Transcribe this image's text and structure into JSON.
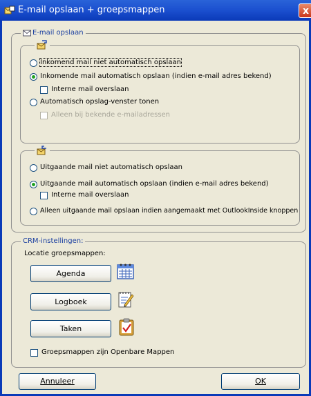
{
  "window": {
    "title": "E-mail opslaan + groepsmappen",
    "close_label": "x"
  },
  "email_section": {
    "legend": "E-mail opslaan",
    "incoming": {
      "radio_not_auto": "Inkomend mail niet automatisch opslaan",
      "radio_auto": "Inkomende mail automatisch opslaan (indien e-mail adres bekend)",
      "check_internal": "Interne mail overslaan",
      "radio_window": "Automatisch opslag-venster tonen",
      "check_known_only": "Alleen bij bekende e-mailadressen",
      "selected": "auto"
    },
    "outgoing": {
      "radio_not_auto": "Uitgaande mail niet automatisch opslaan",
      "radio_auto": "Uitgaande mail automatisch opslaan (indien e-mail adres bekend)",
      "check_internal": "Interne mail overslaan",
      "radio_only_outlook": "Alleen uitgaande mail opslaan indien aangemaakt met OutlookInside knoppen",
      "selected": "auto"
    }
  },
  "crm_section": {
    "legend": "CRM-instellingen:",
    "location_label": "Locatie groepsmappen:",
    "buttons": {
      "agenda": "Agenda",
      "logboek": "Logboek",
      "taken": "Taken"
    },
    "icons": {
      "agenda": "calendar-icon",
      "logboek": "notepad-icon",
      "taken": "task-clipboard-icon"
    },
    "check_public_folders": "Groepsmappen zijn Openbare Mappen"
  },
  "footer": {
    "cancel_label": "Annuleer",
    "ok_label": "OK"
  },
  "colors": {
    "titlebar": "#1b4fcf",
    "legend_text": "#1b3fa0",
    "dialog_bg": "#ece9d8"
  }
}
